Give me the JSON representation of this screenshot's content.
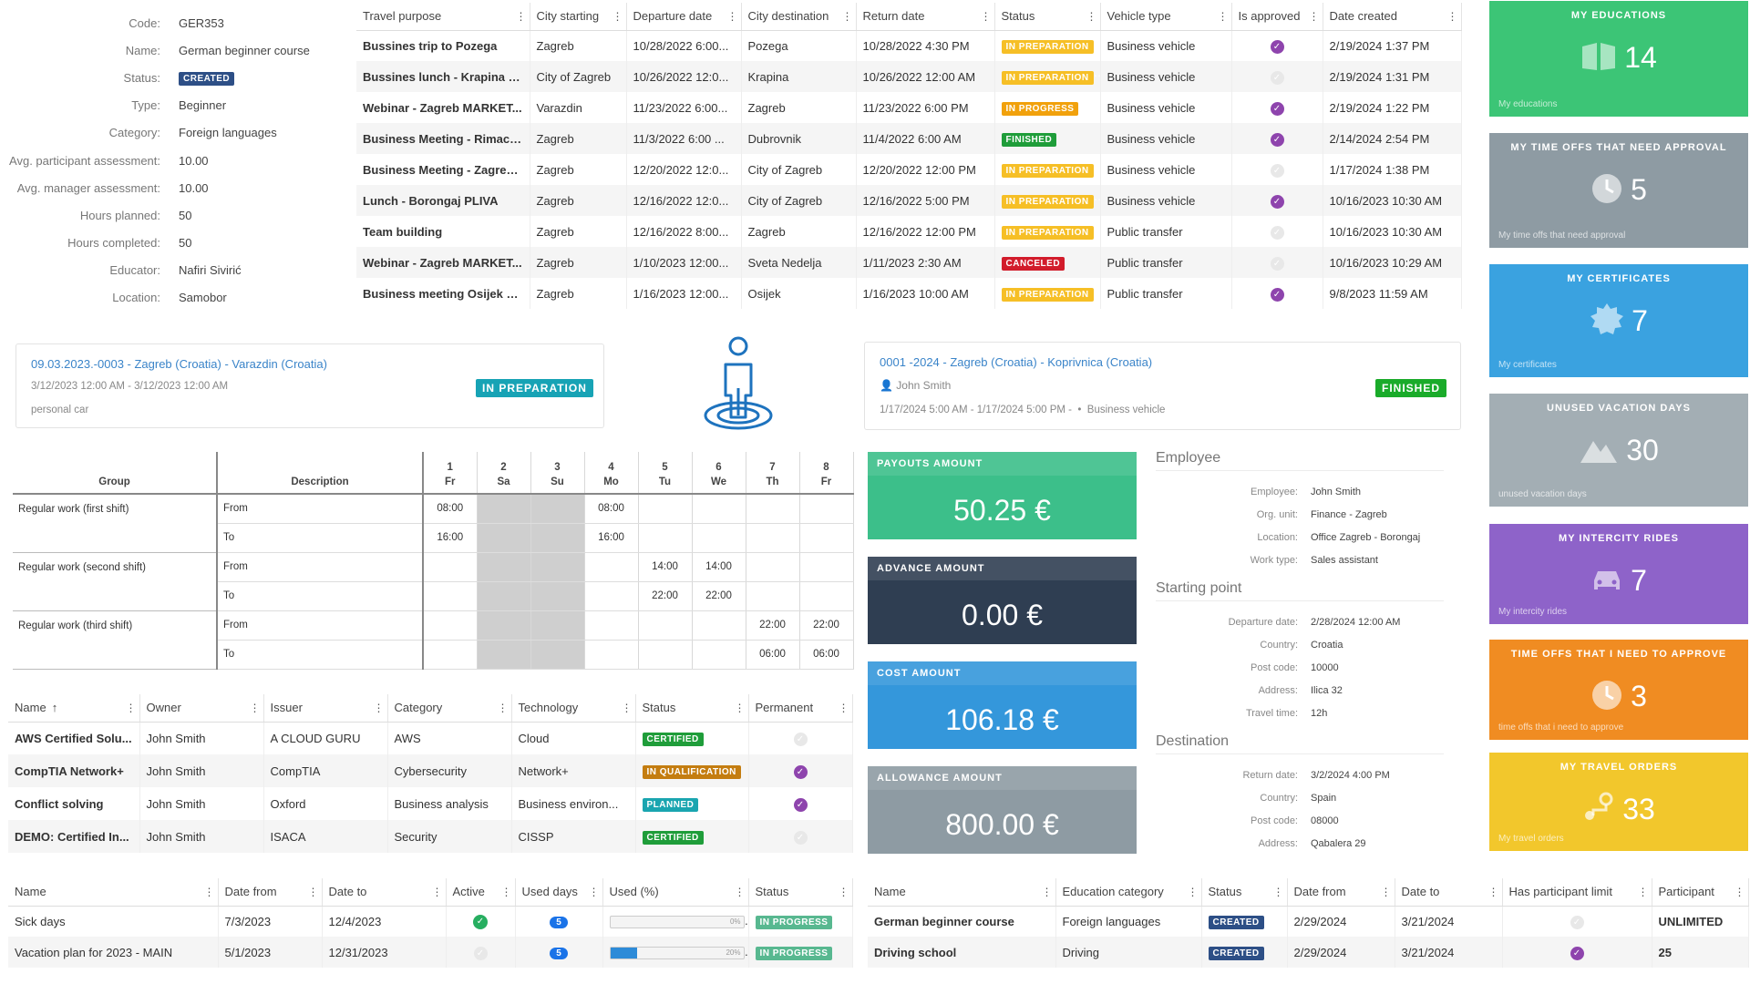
{
  "details": [
    {
      "label": "Code:",
      "value": "GER353"
    },
    {
      "label": "Name:",
      "value": "German beginner course"
    },
    {
      "label": "Status:",
      "value": "CREATED"
    },
    {
      "label": "Type:",
      "value": "Beginner"
    },
    {
      "label": "Category:",
      "value": "Foreign languages"
    },
    {
      "label": "Avg. participant assessment:",
      "value": "10.00"
    },
    {
      "label": "Avg. manager assessment:",
      "value": "10.00"
    },
    {
      "label": "Hours planned:",
      "value": "50"
    },
    {
      "label": "Hours completed:",
      "value": "50"
    },
    {
      "label": "Educator:",
      "value": "Nafiri Sivirić"
    },
    {
      "label": "Location:",
      "value": "Samobor"
    }
  ],
  "travel": {
    "headers": [
      "Travel purpose",
      "City starting",
      "Departure date",
      "City destination",
      "Return date",
      "Status",
      "Vehicle type",
      "Is approved",
      "Date created"
    ],
    "rows": [
      [
        "Bussines trip to Pozega",
        "Zagreb",
        "10/28/2022 6:00...",
        "Pozega",
        "10/28/2022 4:30 PM",
        "IN PREPARATION",
        "Business vehicle",
        "yes",
        "2/19/2024 1:37 PM"
      ],
      [
        "Bussines lunch - Krapina P...",
        "City of Zagreb",
        "10/26/2022 12:0...",
        "Krapina",
        "10/26/2022 12:00 AM",
        "IN PREPARATION",
        "Business vehicle",
        "no",
        "2/19/2024 1:31 PM"
      ],
      [
        "Webinar - Zagreb MARKET...",
        "Varazdin",
        "11/23/2022 6:00...",
        "Zagreb",
        "11/23/2022 6:00 PM",
        "IN PROGRESS",
        "Business vehicle",
        "yes",
        "2/19/2024 1:22 PM"
      ],
      [
        "Business Meeting - Rimac ...",
        "Zagreb",
        "11/3/2022 6:00 ...",
        "Dubrovnik",
        "11/4/2022 6:00 AM",
        "FINISHED",
        "Business vehicle",
        "yes",
        "2/14/2024 2:54 PM"
      ],
      [
        "Business Meeting - Zagreb...",
        "Zagreb",
        "12/20/2022 12:0...",
        "City of Zagreb",
        "12/20/2022 12:00 PM",
        "IN PREPARATION",
        "Business vehicle",
        "no",
        "1/17/2024 1:38 PM"
      ],
      [
        "Lunch - Borongaj PLIVA",
        "Zagreb",
        "12/16/2022 12:0...",
        "City of Zagreb",
        "12/16/2022 5:00 PM",
        "IN PREPARATION",
        "Business vehicle",
        "yes",
        "10/16/2023 10:30 AM"
      ],
      [
        "Team building",
        "Zagreb",
        "12/16/2022 8:00...",
        "Zagreb",
        "12/16/2022 12:00 PM",
        "IN PREPARATION",
        "Public transfer",
        "no",
        "10/16/2023 10:30 AM"
      ],
      [
        "Webinar - Zagreb MARKET...",
        "Zagreb",
        "1/10/2023 12:00...",
        "Sveta Nedelja",
        "1/11/2023 2:30 AM",
        "CANCELED",
        "Public transfer",
        "no",
        "10/16/2023 10:29 AM"
      ],
      [
        "Business meeting Osijek PL...",
        "Zagreb",
        "1/16/2023 12:00...",
        "Osijek",
        "1/16/2023 10:00 AM",
        "IN PREPARATION",
        "Public transfer",
        "yes",
        "9/8/2023 11:59 AM"
      ]
    ]
  },
  "card1": {
    "title": "09.03.2023.-0003 - Zagreb (Croatia) - Varazdin (Croatia)",
    "dates": "3/12/2023 12:00 AM - 3/12/2023 12:00 AM",
    "vehicle": "personal car",
    "status": "IN PREPARATION"
  },
  "card2": {
    "title": "0001 -2024 - Zagreb (Croatia) - Koprivnica (Croatia)",
    "person": "John Smith",
    "dates": "1/17/2024 5:00 AM - 1/17/2024 5:00 PM -",
    "vehicle": "Business vehicle",
    "status": "FINISHED"
  },
  "schedule": {
    "group_header": "Group",
    "desc_header": "Description",
    "days": [
      {
        "num": "1",
        "name": "Fr"
      },
      {
        "num": "2",
        "name": "Sa"
      },
      {
        "num": "3",
        "name": "Su"
      },
      {
        "num": "4",
        "name": "Mo"
      },
      {
        "num": "5",
        "name": "Tu"
      },
      {
        "num": "6",
        "name": "We"
      },
      {
        "num": "7",
        "name": "Th"
      },
      {
        "num": "8",
        "name": "Fr"
      }
    ],
    "groups": [
      {
        "name": "Regular work (first shift)",
        "from": [
          "08:00",
          "",
          "",
          "08:00",
          "",
          "",
          "",
          ""
        ],
        "to": [
          "16:00",
          "",
          "",
          "16:00",
          "",
          "",
          "",
          ""
        ]
      },
      {
        "name": "Regular work (second shift)",
        "from": [
          "",
          "",
          "",
          "",
          "14:00",
          "14:00",
          "",
          ""
        ],
        "to": [
          "",
          "",
          "",
          "",
          "22:00",
          "22:00",
          "",
          ""
        ]
      },
      {
        "name": "Regular work (third shift)",
        "from": [
          "",
          "",
          "",
          "",
          "",
          "",
          "22:00",
          "22:00"
        ],
        "to": [
          "",
          "",
          "",
          "",
          "",
          "",
          "06:00",
          "06:00"
        ]
      }
    ],
    "from_label": "From",
    "to_label": "To"
  },
  "certs": {
    "headers": [
      "Name",
      "Owner",
      "Issuer",
      "Category",
      "Technology",
      "Status",
      "Permanent"
    ],
    "sort_icon": "↑",
    "rows": [
      [
        "AWS Certified Solu...",
        "John Smith",
        "A CLOUD GURU",
        "AWS",
        "Cloud",
        "CERTIFIED",
        "no"
      ],
      [
        "CompTIA Network+",
        "John Smith",
        "CompTIA",
        "Cybersecurity",
        "Network+",
        "IN QUALIFICATION",
        "yes"
      ],
      [
        "Conflict solving",
        "John Smith",
        "Oxford",
        "Business analysis",
        "Business environ...",
        "PLANNED",
        "yes"
      ],
      [
        "DEMO: Certified In...",
        "John Smith",
        "ISACA",
        "Security",
        "CISSP",
        "CERTIFIED",
        "no"
      ]
    ]
  },
  "vacation": {
    "headers": [
      "Name",
      "Date from",
      "Date to",
      "Active",
      "Used days",
      "Used (%)",
      "Status"
    ],
    "rows": [
      {
        "name": "Sick days",
        "from": "7/3/2023",
        "to": "12/4/2023",
        "active": true,
        "used": "5",
        "pct_label": "0%",
        "pct": 0,
        "status": "IN PROGRESS"
      },
      {
        "name": "Vacation plan for 2023 - MAIN",
        "from": "5/1/2023",
        "to": "12/31/2023",
        "active": false,
        "used": "5",
        "pct_label": "20%",
        "pct": 20,
        "status": "IN PROGRESS"
      }
    ]
  },
  "amounts": [
    {
      "title": "PAYOUTS AMOUNT",
      "value": "50.25 €",
      "color": "#3cbf8a"
    },
    {
      "title": "ADVANCE AMOUNT",
      "value": "0.00 €",
      "color": "#2f3e52"
    },
    {
      "title": "COST AMOUNT",
      "value": "106.18 €",
      "color": "#3497db"
    },
    {
      "title": "ALLOWANCE AMOUNT",
      "value": "800.00 €",
      "color": "#8e9ba3"
    }
  ],
  "employee": {
    "section1": "Employee",
    "rows1": [
      {
        "label": "Employee:",
        "value": "John Smith"
      },
      {
        "label": "Org. unit:",
        "value": "Finance - Zagreb"
      },
      {
        "label": "Location:",
        "value": "Office Zagreb - Borongaj"
      },
      {
        "label": "Work type:",
        "value": "Sales assistant"
      }
    ],
    "section2": "Starting point",
    "rows2": [
      {
        "label": "Departure date:",
        "value": "2/28/2024 12:00 AM"
      },
      {
        "label": "Country:",
        "value": "Croatia"
      },
      {
        "label": "Post code:",
        "value": "10000"
      },
      {
        "label": "Address:",
        "value": "Ilica 32"
      },
      {
        "label": "Travel time:",
        "value": "12h"
      }
    ],
    "section3": "Destination",
    "rows3": [
      {
        "label": "Return date:",
        "value": "3/2/2024 4:00 PM"
      },
      {
        "label": "Country:",
        "value": "Spain"
      },
      {
        "label": "Post code:",
        "value": "08000"
      },
      {
        "label": "Address:",
        "value": "Qabalera 29"
      }
    ]
  },
  "tiles": [
    {
      "title": "MY EDUCATIONS",
      "num": "14",
      "foot": "My educations",
      "color": "#3cc576",
      "icon": "book-icon"
    },
    {
      "title": "MY TIME OFFS THAT NEED APPROVAL",
      "num": "5",
      "foot": "My time offs that need approval",
      "color": "#8e9ba3",
      "icon": "clock-icon"
    },
    {
      "title": "MY CERTIFICATES",
      "num": "7",
      "foot": "My certificates",
      "color": "#3aa2e0",
      "icon": "certificate-icon"
    },
    {
      "title": "UNUSED VACATION DAYS",
      "num": "30",
      "foot": "unused vacation days",
      "color": "#a3aeb4",
      "icon": "mountain-icon"
    },
    {
      "title": "MY INTERCITY RIDES",
      "num": "7",
      "foot": "My intercity rides",
      "color": "#8e63c9",
      "icon": "car-icon"
    },
    {
      "title": "TIME OFFS THAT I NEED TO APPROVE",
      "num": "3",
      "foot": "time offs that i need to approve",
      "color": "#f08c22",
      "icon": "clock-icon"
    },
    {
      "title": "MY TRAVEL ORDERS",
      "num": "33",
      "foot": "My travel orders",
      "color": "#f2c72c",
      "icon": "route-icon"
    }
  ],
  "educations": {
    "headers": [
      "Name",
      "Education category",
      "Status",
      "Date from",
      "Date to",
      "Has participant limit",
      "Participant"
    ],
    "rows": [
      {
        "name": "German beginner course",
        "cat": "Foreign languages",
        "status": "CREATED",
        "from": "2/29/2024",
        "to": "3/21/2024",
        "limit": false,
        "part": "UNLIMITED"
      },
      {
        "name": "Driving school",
        "cat": "Driving",
        "status": "CREATED",
        "from": "2/29/2024",
        "to": "3/21/2024",
        "limit": true,
        "part": "25"
      }
    ]
  }
}
